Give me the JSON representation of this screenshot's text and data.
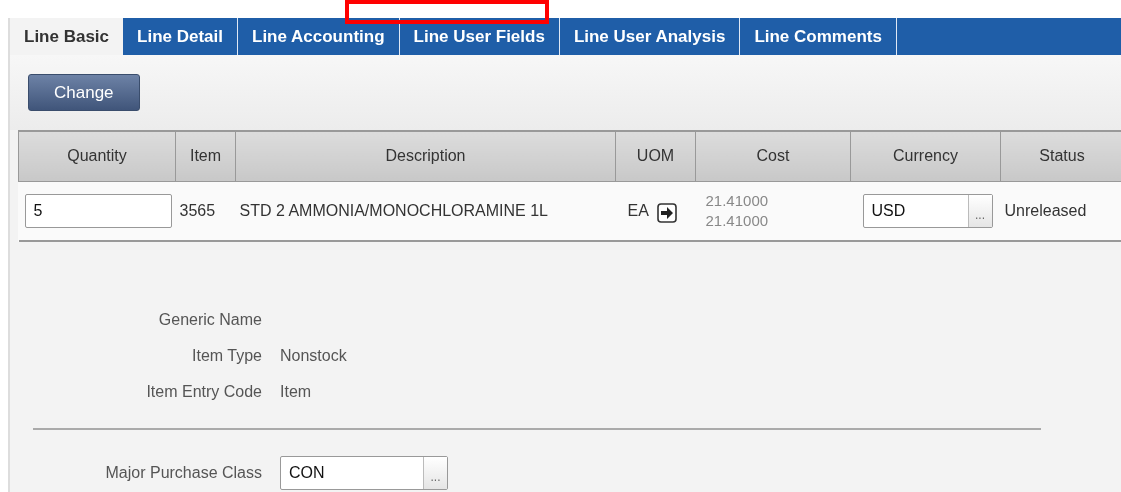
{
  "tabs": [
    {
      "label": "Line Basic",
      "selected": true
    },
    {
      "label": "Line Detail",
      "selected": false
    },
    {
      "label": "Line Accounting",
      "selected": false
    },
    {
      "label": "Line User Fields",
      "selected": false
    },
    {
      "label": "Line User Analysis",
      "selected": false
    },
    {
      "label": "Line Comments",
      "selected": false
    }
  ],
  "annotations": [
    {
      "kind": "frame"
    }
  ],
  "toolbar": {
    "buttons": [
      "Change"
    ]
  },
  "table": {
    "columns": [
      "Quantity",
      "Item",
      "Description",
      "UOM",
      "Cost",
      "Currency",
      "Status"
    ],
    "rows": [
      {
        "quantity": "5",
        "item": "3565",
        "description": "STD 2 AMMONIA/MONOCHLORAMINE 1L",
        "uom": "EA",
        "cost": [
          "21.41000",
          "21.41000"
        ],
        "currency": "USD",
        "currency_lookup": "...",
        "status": "Unreleased"
      }
    ]
  },
  "details": [
    {
      "label": "Generic Name"
    },
    {
      "label": "Item Type",
      "value": "Nonstock"
    },
    {
      "label": "Item Entry Code",
      "value": "Item"
    }
  ],
  "purchase_class": {
    "label": "Major Purchase Class",
    "value": "CON",
    "lookup": "..."
  }
}
